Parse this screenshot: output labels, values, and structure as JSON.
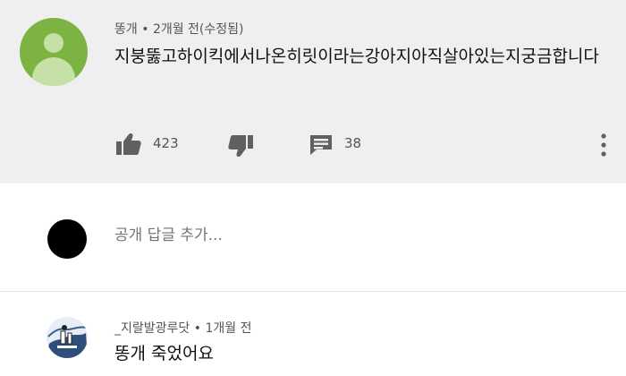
{
  "comment": {
    "author": "똥개",
    "separator": "•",
    "time": "2개월 전(수정됨)",
    "text": "지붕뚫고하이킥에서나온히릿이라는강아지아직살아있는지궁금합니다",
    "likes": "423",
    "replies": "38",
    "icons": {
      "like": "thumbs-up-icon",
      "dislike": "thumbs-down-icon",
      "reply": "reply-icon",
      "more": "more-vertical-icon"
    }
  },
  "reply_box": {
    "placeholder": "공개 답글 추가..."
  },
  "reply": {
    "author": "_지랄발광루닷",
    "separator": "•",
    "time": "1개월 전",
    "text": "똥개 죽었어요"
  },
  "colors": {
    "comment_bg": "#efefef",
    "avatar_green": "#7cb342",
    "icon_gray": "#606060"
  }
}
